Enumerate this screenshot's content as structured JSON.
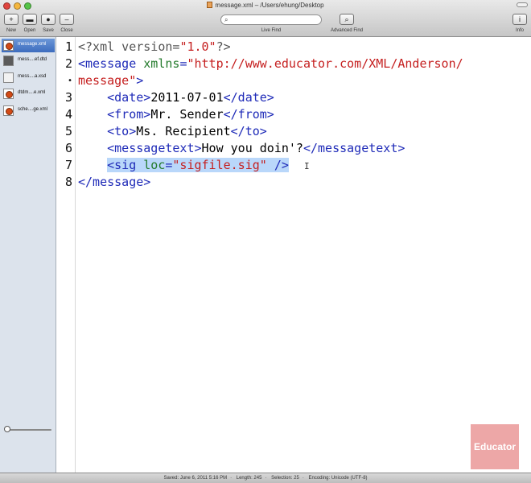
{
  "window": {
    "title": "message.xml – /Users/ehung/Desktop"
  },
  "toolbar": {
    "new_label": "New",
    "open_label": "Open",
    "save_label": "Save",
    "close_label": "Close",
    "live_find_label": "Live Find",
    "advanced_find_label": "Advanced Find",
    "info_label": "Info",
    "search_placeholder": ""
  },
  "sidebar": {
    "files": [
      {
        "name": "message.xml",
        "icon": "xml-file-icon",
        "selected": true
      },
      {
        "name": "mess....ef.dtd",
        "icon": "dtd-file-icon",
        "selected": false
      },
      {
        "name": "mess....a.xsd",
        "icon": "xsd-file-icon",
        "selected": false
      },
      {
        "name": "dtdm....e.xml",
        "icon": "xml-file-icon",
        "selected": false
      },
      {
        "name": "sche....ge.xml",
        "icon": "xml-file-icon",
        "selected": false
      }
    ]
  },
  "editor": {
    "line_numbers": [
      "1",
      "2",
      "•",
      "3",
      "4",
      "5",
      "6",
      "7",
      "8"
    ],
    "code": {
      "l1": {
        "open": "<?xml version=",
        "val": "\"1.0\"",
        "close": "?>"
      },
      "l2": {
        "open": "<message ",
        "attr": "xmlns",
        "eq": "=",
        "val": "\"http://www.educator.com/XML/Anderson/"
      },
      "l2b": {
        "val": "message\"",
        "close": ">"
      },
      "l3": {
        "indent": "    ",
        "open": "<date>",
        "text": "2011-07-01",
        "close": "</date>"
      },
      "l4": {
        "indent": "    ",
        "open": "<from>",
        "text": "Mr. Sender",
        "close": "</from>"
      },
      "l5": {
        "indent": "    ",
        "open": "<to>",
        "text": "Ms. Recipient",
        "close": "</to>"
      },
      "l6": {
        "indent": "    ",
        "open": "<messagetext>",
        "text": "How you doin'?",
        "close": "</messagetext>"
      },
      "l7": {
        "indent": "    ",
        "open": "<sig ",
        "attr": "loc",
        "eq": "=",
        "val": "\"sigfile.sig\"",
        "close": " />"
      },
      "l8": {
        "close": "</message>"
      }
    },
    "cursor": "I"
  },
  "watermark": {
    "text": "Educator"
  },
  "status": {
    "saved": "Saved: June 6, 2011 5:16 PM",
    "length": "Length: 245",
    "selection": "Selection: 25",
    "encoding": "Encoding: Unicode (UTF-8)"
  },
  "colors": {
    "tag": "#1f2bb8",
    "attribute": "#237a2b",
    "value": "#c51f1f",
    "selection": "#b9d7fa"
  }
}
